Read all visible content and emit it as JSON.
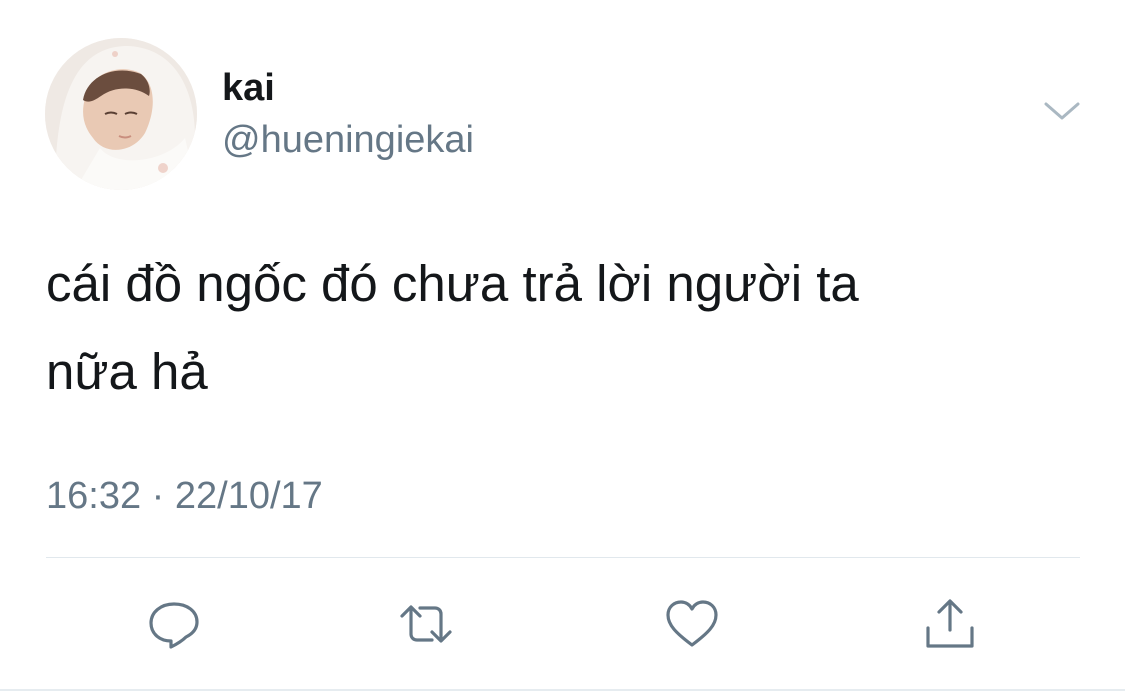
{
  "tweet": {
    "author": {
      "display_name": "kai",
      "handle": "@hueningiekai",
      "avatar": "avatar-photo"
    },
    "text_line1": "cái đồ ngốc đó chưa trả lời người ta",
    "text_line2": "nữa hả",
    "timestamp": "16:32 · 22/10/17",
    "menu_icon": "chevron-down-icon",
    "actions": [
      {
        "name": "reply",
        "icon": "speech-bubble-icon"
      },
      {
        "name": "retweet",
        "icon": "retweet-arrows-icon"
      },
      {
        "name": "like",
        "icon": "heart-icon"
      },
      {
        "name": "share",
        "icon": "share-upload-icon"
      }
    ]
  },
  "colors": {
    "text_primary": "#14171a",
    "text_secondary": "#657786",
    "icon": "#657786",
    "divider": "#e1e8ed",
    "background": "#ffffff"
  }
}
